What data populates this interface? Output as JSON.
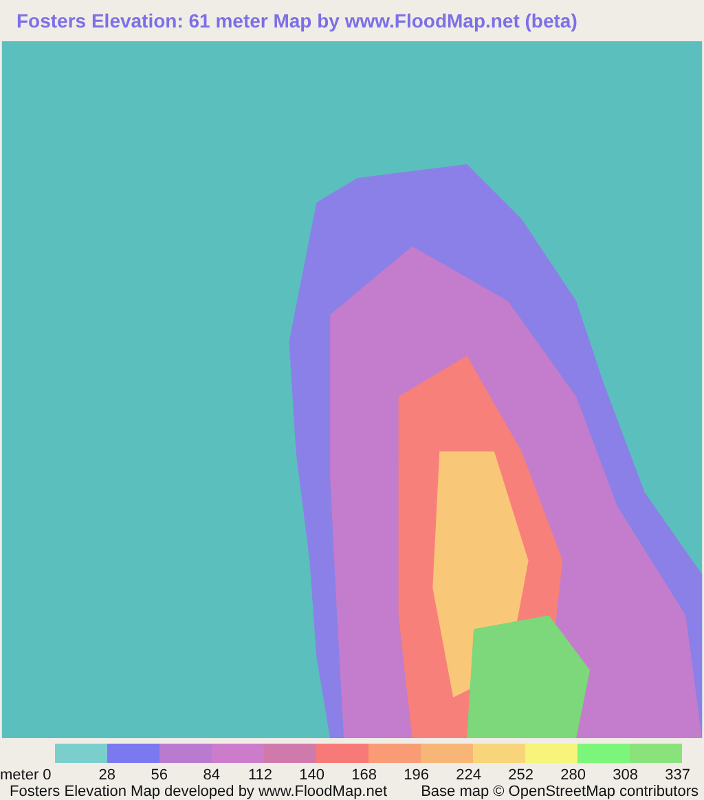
{
  "title": "Fosters Elevation: 61 meter Map by www.FloodMap.net (beta)",
  "legend": {
    "unit": "meter",
    "swatches": [
      {
        "color": "#7acfcd"
      },
      {
        "color": "#7b78f0"
      },
      {
        "color": "#b97bd0"
      },
      {
        "color": "#cd7ccc"
      },
      {
        "color": "#d07aab"
      },
      {
        "color": "#f87a78"
      },
      {
        "color": "#f99b74"
      },
      {
        "color": "#f8b676"
      },
      {
        "color": "#f8d57a"
      },
      {
        "color": "#f6f47a"
      },
      {
        "color": "#7cf67a"
      },
      {
        "color": "#8ae27a"
      }
    ],
    "ticks": [
      "0",
      "28",
      "56",
      "84",
      "112",
      "140",
      "168",
      "196",
      "224",
      "252",
      "280",
      "308",
      "337"
    ]
  },
  "footer": {
    "credit": "Fosters Elevation Map developed by www.FloodMap.net",
    "attribution": "Base map © OpenStreetMap contributors"
  }
}
